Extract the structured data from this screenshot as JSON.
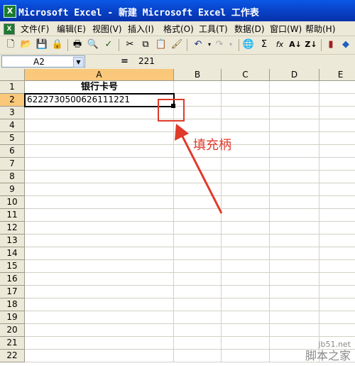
{
  "window": {
    "title": "Microsoft Excel - 新建 Microsoft Excel 工作表",
    "app_icon": "excel-icon"
  },
  "menu": [
    {
      "label": "文件(F)"
    },
    {
      "label": "编辑(E)"
    },
    {
      "label": "视图(V)"
    },
    {
      "label": "插入(I)"
    },
    {
      "label": "格式(O)"
    },
    {
      "label": "工具(T)"
    },
    {
      "label": "数据(D)"
    },
    {
      "label": "窗口(W)"
    },
    {
      "label": "帮助(H)"
    }
  ],
  "formula_bar": {
    "name_box": "A2",
    "equals": "=",
    "value": "221"
  },
  "columns": [
    "A",
    "B",
    "C",
    "D",
    "E"
  ],
  "rows": [
    "1",
    "2",
    "3",
    "4",
    "5",
    "6",
    "7",
    "8",
    "9",
    "10",
    "11",
    "12",
    "13",
    "14",
    "15",
    "16",
    "17",
    "18",
    "19",
    "20",
    "21",
    "22"
  ],
  "cells": {
    "A1": "银行卡号",
    "A2": "6222730500626111221"
  },
  "annotation": {
    "label": "填充柄",
    "color": "#e03a2a"
  },
  "watermark": {
    "site": "jb51.net",
    "name": "脚本之家"
  }
}
